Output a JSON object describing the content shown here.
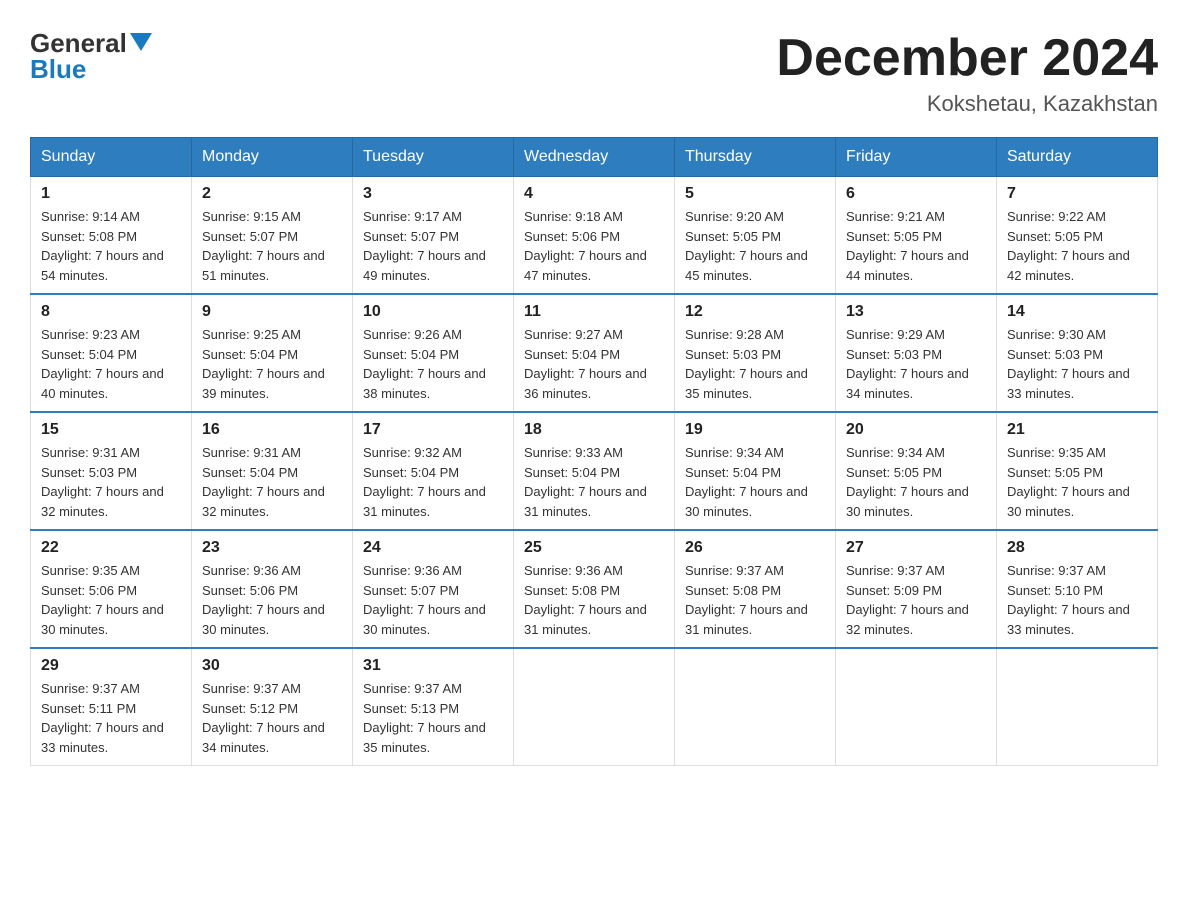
{
  "header": {
    "logo_general": "General",
    "logo_blue": "Blue",
    "month_title": "December 2024",
    "location": "Kokshetau, Kazakhstan"
  },
  "days_of_week": [
    "Sunday",
    "Monday",
    "Tuesday",
    "Wednesday",
    "Thursday",
    "Friday",
    "Saturday"
  ],
  "weeks": [
    [
      {
        "day": "1",
        "sunrise": "9:14 AM",
        "sunset": "5:08 PM",
        "daylight": "7 hours and 54 minutes."
      },
      {
        "day": "2",
        "sunrise": "9:15 AM",
        "sunset": "5:07 PM",
        "daylight": "7 hours and 51 minutes."
      },
      {
        "day": "3",
        "sunrise": "9:17 AM",
        "sunset": "5:07 PM",
        "daylight": "7 hours and 49 minutes."
      },
      {
        "day": "4",
        "sunrise": "9:18 AM",
        "sunset": "5:06 PM",
        "daylight": "7 hours and 47 minutes."
      },
      {
        "day": "5",
        "sunrise": "9:20 AM",
        "sunset": "5:05 PM",
        "daylight": "7 hours and 45 minutes."
      },
      {
        "day": "6",
        "sunrise": "9:21 AM",
        "sunset": "5:05 PM",
        "daylight": "7 hours and 44 minutes."
      },
      {
        "day": "7",
        "sunrise": "9:22 AM",
        "sunset": "5:05 PM",
        "daylight": "7 hours and 42 minutes."
      }
    ],
    [
      {
        "day": "8",
        "sunrise": "9:23 AM",
        "sunset": "5:04 PM",
        "daylight": "7 hours and 40 minutes."
      },
      {
        "day": "9",
        "sunrise": "9:25 AM",
        "sunset": "5:04 PM",
        "daylight": "7 hours and 39 minutes."
      },
      {
        "day": "10",
        "sunrise": "9:26 AM",
        "sunset": "5:04 PM",
        "daylight": "7 hours and 38 minutes."
      },
      {
        "day": "11",
        "sunrise": "9:27 AM",
        "sunset": "5:04 PM",
        "daylight": "7 hours and 36 minutes."
      },
      {
        "day": "12",
        "sunrise": "9:28 AM",
        "sunset": "5:03 PM",
        "daylight": "7 hours and 35 minutes."
      },
      {
        "day": "13",
        "sunrise": "9:29 AM",
        "sunset": "5:03 PM",
        "daylight": "7 hours and 34 minutes."
      },
      {
        "day": "14",
        "sunrise": "9:30 AM",
        "sunset": "5:03 PM",
        "daylight": "7 hours and 33 minutes."
      }
    ],
    [
      {
        "day": "15",
        "sunrise": "9:31 AM",
        "sunset": "5:03 PM",
        "daylight": "7 hours and 32 minutes."
      },
      {
        "day": "16",
        "sunrise": "9:31 AM",
        "sunset": "5:04 PM",
        "daylight": "7 hours and 32 minutes."
      },
      {
        "day": "17",
        "sunrise": "9:32 AM",
        "sunset": "5:04 PM",
        "daylight": "7 hours and 31 minutes."
      },
      {
        "day": "18",
        "sunrise": "9:33 AM",
        "sunset": "5:04 PM",
        "daylight": "7 hours and 31 minutes."
      },
      {
        "day": "19",
        "sunrise": "9:34 AM",
        "sunset": "5:04 PM",
        "daylight": "7 hours and 30 minutes."
      },
      {
        "day": "20",
        "sunrise": "9:34 AM",
        "sunset": "5:05 PM",
        "daylight": "7 hours and 30 minutes."
      },
      {
        "day": "21",
        "sunrise": "9:35 AM",
        "sunset": "5:05 PM",
        "daylight": "7 hours and 30 minutes."
      }
    ],
    [
      {
        "day": "22",
        "sunrise": "9:35 AM",
        "sunset": "5:06 PM",
        "daylight": "7 hours and 30 minutes."
      },
      {
        "day": "23",
        "sunrise": "9:36 AM",
        "sunset": "5:06 PM",
        "daylight": "7 hours and 30 minutes."
      },
      {
        "day": "24",
        "sunrise": "9:36 AM",
        "sunset": "5:07 PM",
        "daylight": "7 hours and 30 minutes."
      },
      {
        "day": "25",
        "sunrise": "9:36 AM",
        "sunset": "5:08 PM",
        "daylight": "7 hours and 31 minutes."
      },
      {
        "day": "26",
        "sunrise": "9:37 AM",
        "sunset": "5:08 PM",
        "daylight": "7 hours and 31 minutes."
      },
      {
        "day": "27",
        "sunrise": "9:37 AM",
        "sunset": "5:09 PM",
        "daylight": "7 hours and 32 minutes."
      },
      {
        "day": "28",
        "sunrise": "9:37 AM",
        "sunset": "5:10 PM",
        "daylight": "7 hours and 33 minutes."
      }
    ],
    [
      {
        "day": "29",
        "sunrise": "9:37 AM",
        "sunset": "5:11 PM",
        "daylight": "7 hours and 33 minutes."
      },
      {
        "day": "30",
        "sunrise": "9:37 AM",
        "sunset": "5:12 PM",
        "daylight": "7 hours and 34 minutes."
      },
      {
        "day": "31",
        "sunrise": "9:37 AM",
        "sunset": "5:13 PM",
        "daylight": "7 hours and 35 minutes."
      },
      null,
      null,
      null,
      null
    ]
  ],
  "labels": {
    "sunrise_prefix": "Sunrise: ",
    "sunset_prefix": "Sunset: ",
    "daylight_prefix": "Daylight: "
  }
}
